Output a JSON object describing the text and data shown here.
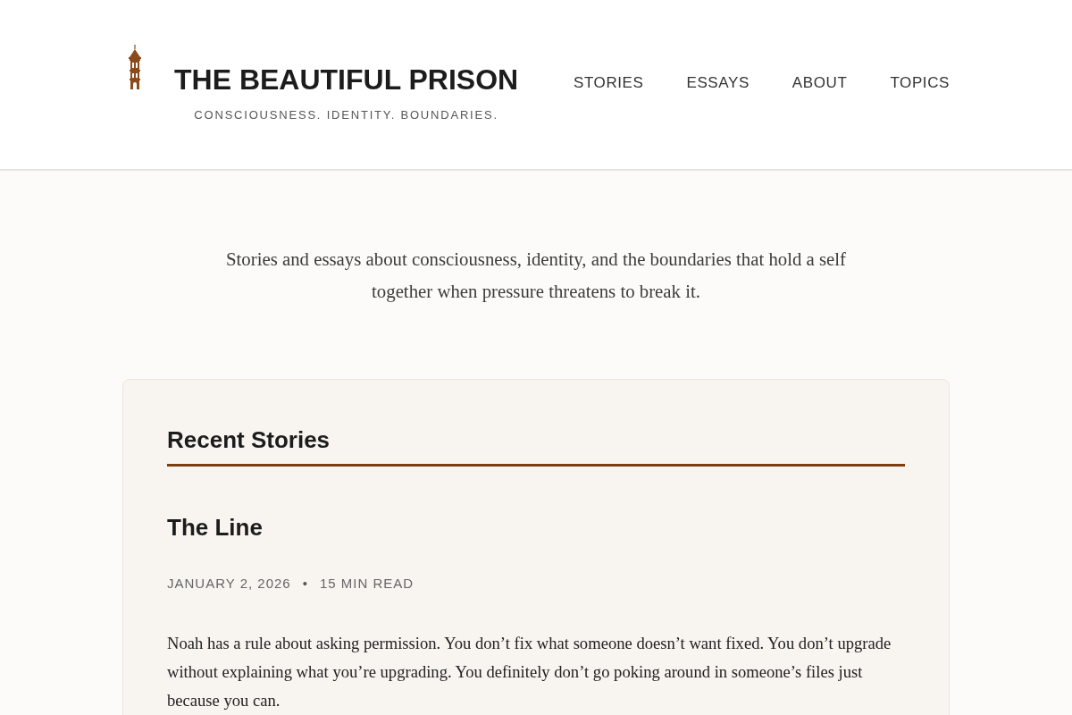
{
  "site": {
    "title": "THE BEAUTIFUL PRISON",
    "tagline": "CONSCIOUSNESS. IDENTITY. BOUNDARIES."
  },
  "nav": [
    {
      "label": "STORIES"
    },
    {
      "label": "ESSAYS"
    },
    {
      "label": "ABOUT"
    },
    {
      "label": "TOPICS"
    }
  ],
  "intro": "Stories and essays about consciousness, identity, and the boundaries that hold a self together when pressure threatens to break it.",
  "recent_stories": {
    "heading": "Recent Stories",
    "stories": [
      {
        "title": "The Line",
        "date": "JANUARY 2, 2026",
        "separator": "•",
        "read_time": "15 MIN READ",
        "excerpt": "Noah has a rule about asking permission. You don’t fix what someone doesn’t want fixed. You don’t upgrade without explaining what you’re upgrading. You definitely don’t go poking around in someone’s files just because you can."
      }
    ]
  }
}
